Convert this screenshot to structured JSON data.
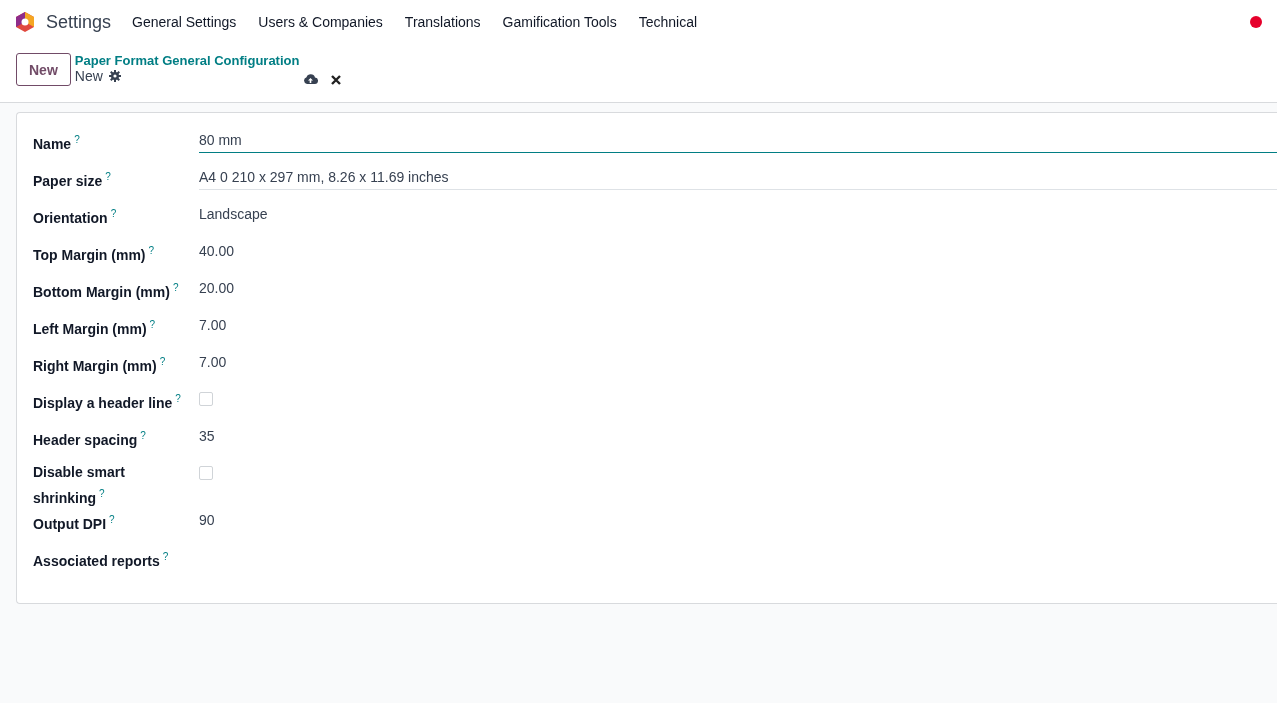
{
  "navbar": {
    "app_title": "Settings",
    "menu": [
      "General Settings",
      "Users & Companies",
      "Translations",
      "Gamification Tools",
      "Technical"
    ]
  },
  "control_panel": {
    "new_button": "New",
    "breadcrumb": "Paper Format General Configuration",
    "record": "New"
  },
  "form": {
    "fields": [
      {
        "kind": "input",
        "label": "Name",
        "help": "?",
        "value": "80 mm"
      },
      {
        "kind": "select",
        "label": "Paper size",
        "help": "?",
        "value": "A4 0 210 x 297 mm, 8.26 x 11.69 inches"
      },
      {
        "kind": "text",
        "label": "Orientation",
        "help": "?",
        "value": "Landscape"
      },
      {
        "kind": "text",
        "label": "Top Margin (mm)",
        "help": "?",
        "value": "40.00"
      },
      {
        "kind": "text",
        "label": "Bottom Margin (mm)",
        "help": "?",
        "value": "20.00"
      },
      {
        "kind": "text",
        "label": "Left Margin (mm)",
        "help": "?",
        "value": "7.00"
      },
      {
        "kind": "text",
        "label": "Right Margin (mm)",
        "help": "?",
        "value": "7.00"
      },
      {
        "kind": "checkbox",
        "label": "Display a header line",
        "help": "?",
        "checked": false
      },
      {
        "kind": "text",
        "label": "Header spacing",
        "help": "?",
        "value": "35"
      },
      {
        "kind": "checkbox",
        "label": "Disable smart shrinking",
        "help": "?",
        "checked": false
      },
      {
        "kind": "text",
        "label": "Output DPI",
        "help": "?",
        "value": "90"
      },
      {
        "kind": "empty",
        "label": "Associated reports",
        "help": "?"
      }
    ]
  }
}
